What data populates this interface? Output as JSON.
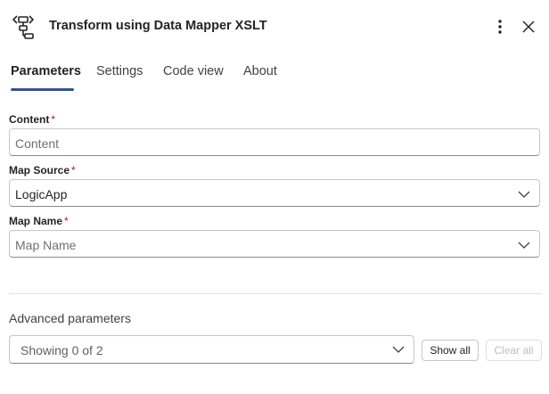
{
  "header": {
    "title": "Transform using Data Mapper XSLT",
    "icon": "data-mapper-icon",
    "more_icon": "more-vertical-icon",
    "close_icon": "close-icon"
  },
  "tabs": [
    {
      "label": "Parameters",
      "active": true
    },
    {
      "label": "Settings",
      "active": false
    },
    {
      "label": "Code view",
      "active": false
    },
    {
      "label": "About",
      "active": false
    }
  ],
  "fields": {
    "content": {
      "label": "Content",
      "required_mark": "*",
      "value": "",
      "placeholder": "Content"
    },
    "map_source": {
      "label": "Map Source",
      "required_mark": "*",
      "value": "LogicApp"
    },
    "map_name": {
      "label": "Map Name",
      "required_mark": "*",
      "value": "",
      "placeholder": "Map Name"
    }
  },
  "advanced": {
    "label": "Advanced parameters",
    "dropdown_text": "Showing 0 of 2",
    "show_all_label": "Show all",
    "clear_all_label": "Clear all"
  },
  "colors": {
    "accent": "#2f5596",
    "required": "#c50f1f",
    "border": "#c7c7c7"
  }
}
